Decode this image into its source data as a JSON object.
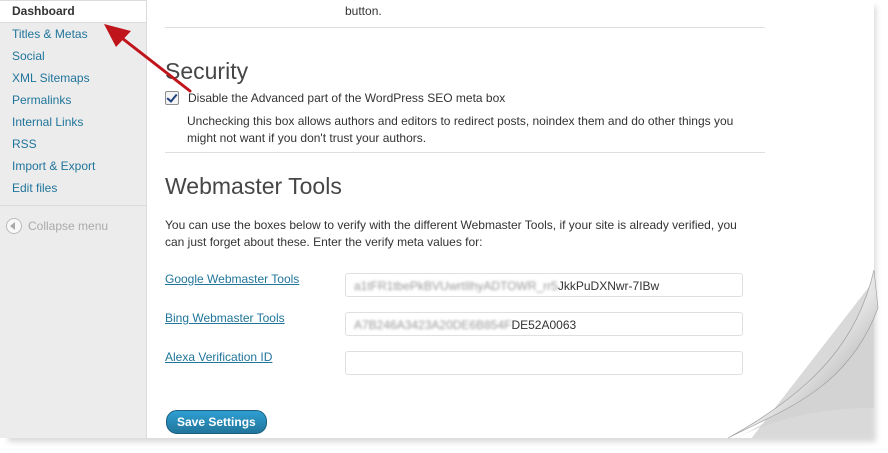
{
  "sidebar": {
    "items": [
      {
        "label": "Dashboard"
      },
      {
        "label": "Titles & Metas"
      },
      {
        "label": "Social"
      },
      {
        "label": "XML Sitemaps"
      },
      {
        "label": "Permalinks"
      },
      {
        "label": "Internal Links"
      },
      {
        "label": "RSS"
      },
      {
        "label": "Import & Export"
      },
      {
        "label": "Edit files"
      }
    ],
    "collapse_label": "Collapse menu"
  },
  "main": {
    "top_text": "button.",
    "security": {
      "heading": "Security",
      "checkbox_label": "Disable the Advanced part of the WordPress SEO meta box",
      "checked": true,
      "description": "Unchecking this box allows authors and editors to redirect posts, noindex them and do other things you might not want if you don't trust your authors."
    },
    "webmaster": {
      "heading": "Webmaster Tools",
      "intro": "You can use the boxes below to verify with the different Webmaster Tools, if your site is already verified, you can just forget about these. Enter the verify meta values for:",
      "fields": [
        {
          "label": "Google Webmaster Tools",
          "value_blurred": "a1tFR1tbePkBVUwrtIlhyADTOWR_rr5",
          "value_visible": "JkkPuDXNwr-7IBw"
        },
        {
          "label": "Bing Webmaster Tools",
          "value_blurred": "A7B246A3423A20DE6B854F",
          "value_visible": "DE52A0063"
        },
        {
          "label": "Alexa Verification ID",
          "value_blurred": "",
          "value_visible": ""
        }
      ],
      "save_label": "Save Settings"
    }
  },
  "colors": {
    "link": "#21759b",
    "annotation_arrow": "#c0141b",
    "button": "#21759b"
  }
}
